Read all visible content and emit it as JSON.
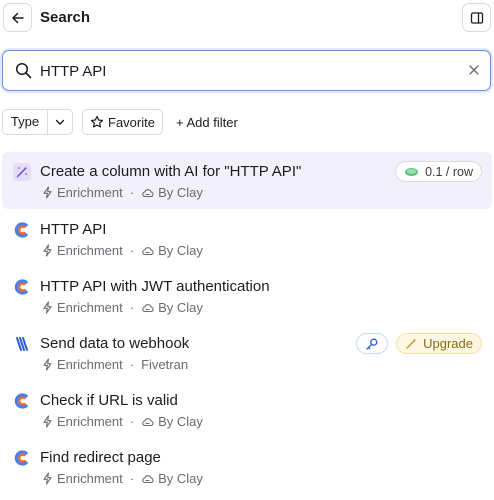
{
  "header": {
    "title": "Search",
    "back_icon": "arrow-left-icon",
    "panel_icon": "sidebar-panel-icon"
  },
  "search": {
    "value": "HTTP API",
    "search_icon": "search-icon",
    "clear_icon": "close-icon"
  },
  "filters": {
    "type_label": "Type",
    "favorite_label": "Favorite",
    "add_filter_label": "+ Add filter"
  },
  "results": [
    {
      "icon": "ai-sparkle-icon",
      "title": "Create a column with AI for \"HTTP API\"",
      "category": "Enrichment",
      "provider": "By Clay",
      "badge": "0.1 / row",
      "highlighted": true
    },
    {
      "icon": "clay-logo-icon",
      "title": "HTTP API",
      "category": "Enrichment",
      "provider": "By Clay"
    },
    {
      "icon": "clay-logo-icon",
      "title": "HTTP API with JWT authentication",
      "category": "Enrichment",
      "provider": "By Clay"
    },
    {
      "icon": "fivetran-logo-icon",
      "title": "Send data to webhook",
      "category": "Enrichment",
      "provider": "Fivetran",
      "upgrade": "Upgrade"
    },
    {
      "icon": "clay-logo-icon",
      "title": "Check if URL is valid",
      "category": "Enrichment",
      "provider": "By Clay"
    },
    {
      "icon": "clay-logo-icon",
      "title": "Find redirect page",
      "category": "Enrichment",
      "provider": "By Clay"
    }
  ],
  "colors": {
    "accent": "#6b8fd6",
    "highlight": "#f1f0fb",
    "ai_purple": "#7c5bd6",
    "clay_orange": "#ee6a2a",
    "clay_blue": "#4a7ee8",
    "fivetran_blue": "#2b5fd9",
    "credit_green": "#3fa45b",
    "upgrade_bg": "#fdf7e3"
  }
}
